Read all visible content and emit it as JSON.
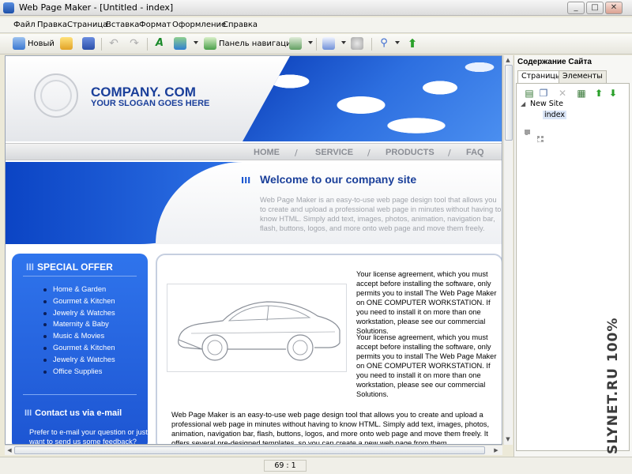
{
  "window": {
    "title": "Web Page Maker - [Untitled - index]",
    "controls": [
      "_",
      "□",
      "✕"
    ]
  },
  "menu": [
    "Файл",
    "Правка",
    "Страница",
    "Вставка",
    "Формат",
    "Оформление",
    "Справка"
  ],
  "toolbar": {
    "new_label": "Новый",
    "nav_panel_label": "Панель навигации"
  },
  "page": {
    "company": "COMPANY. COM",
    "slogan": "YOUR SLOGAN GOES HERE",
    "nav": [
      "HOME",
      "SERVICE",
      "PRODUCTS",
      "FAQ"
    ],
    "nav_sep": "/",
    "welcome_bars": "III",
    "welcome_title": "Welcome to our company site",
    "intro": "Web Page Maker is an easy-to-use web page design tool that allows you to create and upload a professional web page in minutes without having to know HTML. Simply add text, images, photos, animation, navigation bar, flash, buttons, logos, and more onto web page and move them freely.",
    "special_bars": "III",
    "special_title": "SPECIAL  OFFER",
    "offers": [
      "Home & Garden",
      "Gourmet & Kitchen",
      "Jewelry & Watches",
      "Maternity & Baby",
      "Music & Movies",
      "Gourmet & Kitchen",
      "Jewelry & Watches",
      "Office Supplies"
    ],
    "contact_bars": "III",
    "contact_title": "Contact us via e-mail",
    "contact_text": "Prefer to e-mail your question or just want to send us some feedback?",
    "license_1": "Your license agreement, which you must accept before installing the software, only permits you to install The Web Page Maker on ONE COMPUTER WORKSTATION. If you need to install it on more than one workstation, please see our commercial Solutions.",
    "license_2": "Your license agreement, which you must accept before installing the software, only permits you to install The Web Page Maker on ONE COMPUTER WORKSTATION. If you need to install it on more than one workstation, please see our commercial Solutions.",
    "bottom_text": "Web Page Maker is an easy-to-use web page design tool that allows you to create and upload a professional web page in minutes without having to know HTML. Simply add text, images, photos, animation, navigation bar, flash, buttons, logos, and more onto web page and move them freely. It offers several pre-designed templates, so you can create a new web page from them."
  },
  "status": {
    "position": "69 : 1"
  },
  "site_panel": {
    "title": "Содержание Сайта",
    "tabs": [
      "Страницы",
      "Элементы"
    ],
    "tree_root": "New Site",
    "tree_page": "index"
  },
  "watermark": "SLYNET.RU 100%",
  "colors": {
    "brand_blue": "#1a3f9a",
    "panel_blue": "#2f74ec",
    "nav_gray": "#8a8d94"
  }
}
